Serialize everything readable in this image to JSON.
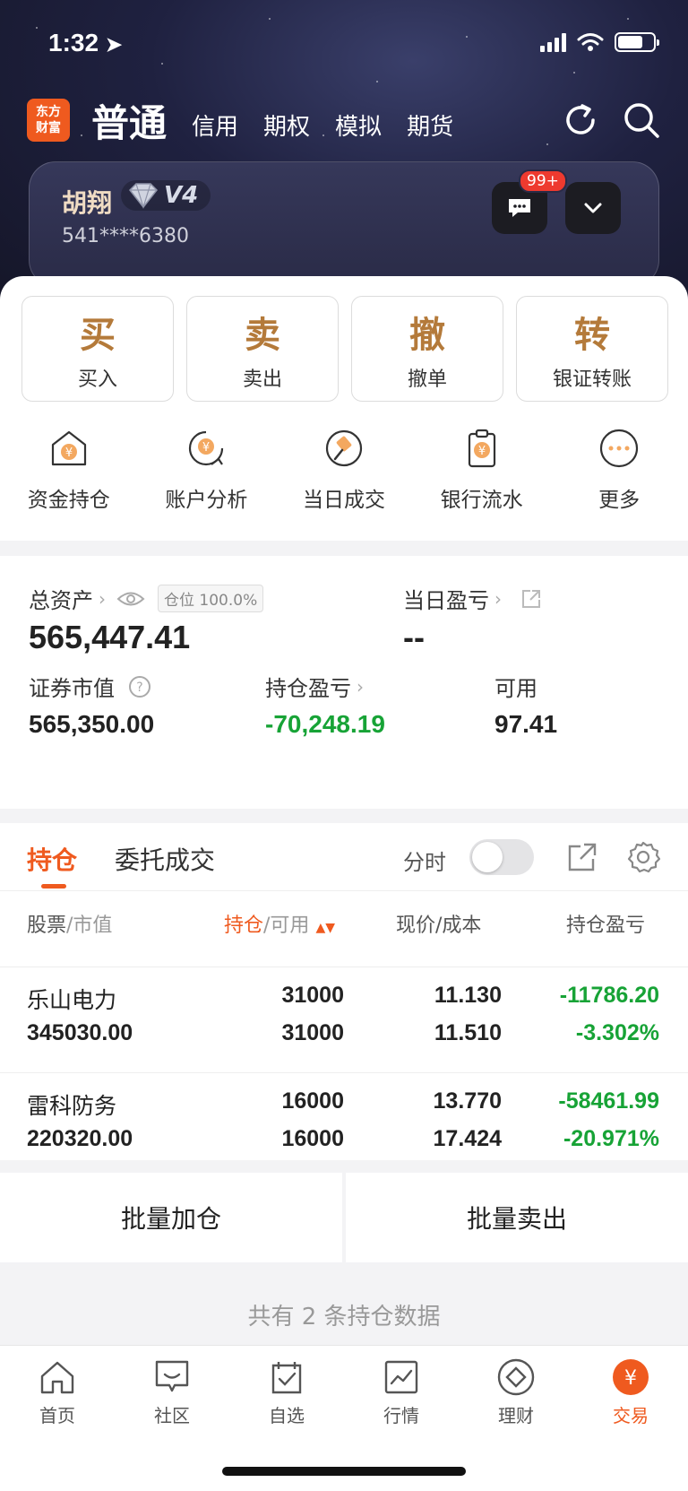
{
  "status": {
    "time": "1:32"
  },
  "brand": {
    "logo_text": "东方财富"
  },
  "header": {
    "tabs": [
      {
        "label": "普通"
      },
      {
        "label": "信用"
      },
      {
        "label": "期权"
      },
      {
        "label": "模拟"
      },
      {
        "label": "期货"
      }
    ]
  },
  "account": {
    "name": "胡翔",
    "level": "V4",
    "number": "541****6380",
    "message_badge": "99+"
  },
  "actions": [
    {
      "big": "买",
      "label": "买入"
    },
    {
      "big": "卖",
      "label": "卖出"
    },
    {
      "big": "撤",
      "label": "撤单"
    },
    {
      "big": "转",
      "label": "银证转账"
    }
  ],
  "quick": [
    {
      "label": "资金持仓",
      "icon": "wallet-yen-icon"
    },
    {
      "label": "账户分析",
      "icon": "analysis-yen-icon"
    },
    {
      "label": "当日成交",
      "icon": "gavel-icon"
    },
    {
      "label": "银行流水",
      "icon": "clipboard-yen-icon"
    },
    {
      "label": "更多",
      "icon": "more-icon"
    }
  ],
  "assets": {
    "total_label": "总资产",
    "position_tag": "仓位 100.0%",
    "total_value": "565,447.41",
    "daily_pnl_label": "当日盈亏",
    "daily_pnl_value": "--",
    "market_value_label": "证券市值",
    "market_value": "565,350.00",
    "holding_pnl_label": "持仓盈亏",
    "holding_pnl": "-70,248.19",
    "available_label": "可用",
    "available": "97.41"
  },
  "positions": {
    "tab_active": "持仓",
    "tab_inactive": "委托成交",
    "fenshi_label": "分时",
    "headers": {
      "stock": "股票",
      "market": "/市值",
      "hold": "持仓",
      "avail": "/可用",
      "price": "现价/成本",
      "pnl": "持仓盈亏"
    },
    "rows": [
      {
        "name": "乐山电力",
        "market_value": "345030.00",
        "hold": "31000",
        "avail": "31000",
        "price": "11.130",
        "cost": "11.510",
        "pnl": "-11786.20",
        "pnl_pct": "-3.302%"
      },
      {
        "name": "雷科防务",
        "market_value": "220320.00",
        "hold": "16000",
        "avail": "16000",
        "price": "13.770",
        "cost": "17.424",
        "pnl": "-58461.99",
        "pnl_pct": "-20.971%"
      }
    ],
    "batch_add": "批量加仓",
    "batch_sell": "批量卖出",
    "footer": "共有 2 条持仓数据"
  },
  "tabbar": [
    {
      "label": "首页",
      "icon": "home-icon"
    },
    {
      "label": "社区",
      "icon": "community-icon"
    },
    {
      "label": "自选",
      "icon": "watchlist-icon"
    },
    {
      "label": "行情",
      "icon": "market-chart-icon"
    },
    {
      "label": "理财",
      "icon": "wealth-diamond-icon"
    },
    {
      "label": "交易",
      "icon": "trade-yen-icon"
    }
  ],
  "colors": {
    "accent": "#ef5a1f",
    "gold": "#b47a3a",
    "loss_green": "#17a336"
  }
}
